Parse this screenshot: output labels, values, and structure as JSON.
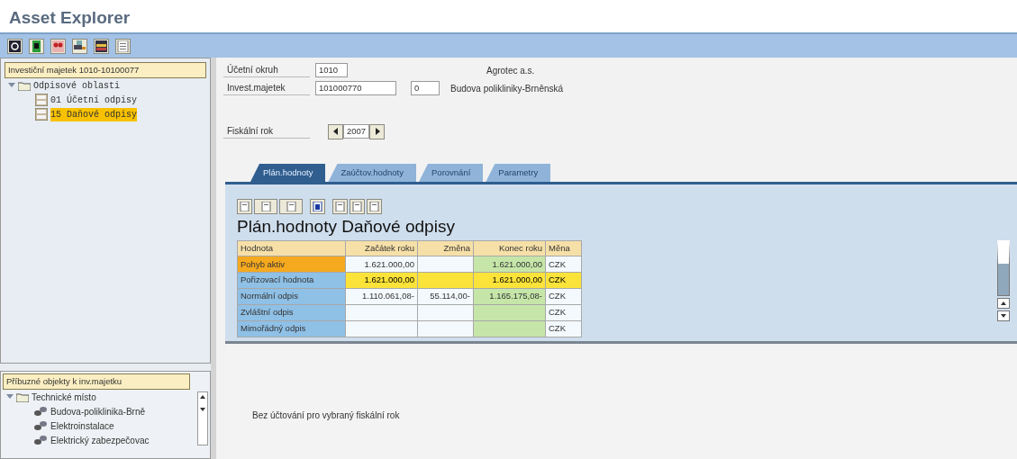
{
  "window": {
    "title": "Asset Explorer"
  },
  "left_panel": {
    "header": "Investiční majetek 1010-10100077",
    "tree": [
      {
        "label": "Odpisové oblasti",
        "expanded": true,
        "selected": false,
        "children": [
          {
            "label": "01 Účetní odpisy",
            "selected": false
          },
          {
            "label": "15 Daňové odpisy",
            "selected": true
          }
        ]
      }
    ]
  },
  "related_panel": {
    "header": "Příbuzné objekty k inv.majetku",
    "tree": [
      {
        "label": "Technické místo",
        "expanded": true,
        "children": [
          {
            "label": "Budova-poliklinika-Brně"
          },
          {
            "label": "Elektroinstalace"
          },
          {
            "label": "Elektrický zabezpečovac"
          }
        ]
      }
    ]
  },
  "fields": [
    {
      "label": "Účetní okruh",
      "value": "1010",
      "description": "Agrotec a.s."
    },
    {
      "label": "Invest.majetek",
      "value": "101000770",
      "extra": "0",
      "description": "Budova polikliniky-Brněnská"
    }
  ],
  "fiscal_year": {
    "label": "Fiskální rok",
    "value": "2007"
  },
  "tabs": [
    {
      "label": "Plán.hodnoty",
      "selected": true
    },
    {
      "label": "Zaúčtov.hodnoty",
      "selected": false
    },
    {
      "label": "Porovnání",
      "selected": false
    },
    {
      "label": "Parametry",
      "selected": false
    }
  ],
  "grid": {
    "title": "Plán.hodnoty Daňové odpisy",
    "columns": [
      "Hodnota",
      "Začátek roku",
      "Změna",
      "Konec roku",
      "Měna"
    ],
    "rows": [
      {
        "cells": [
          "Pohyb aktiv",
          "1.621.000,00",
          "",
          "1.621.000,00",
          "CZK"
        ],
        "selected": true,
        "highlighted": false
      },
      {
        "cells": [
          "Pořizovací hodnota",
          "1.621.000,00",
          "",
          "1.621.000,00",
          "CZK"
        ],
        "selected": false,
        "highlighted": true
      },
      {
        "cells": [
          "Normální odpis",
          "1.110.061,08-",
          "55.114,00-",
          "1.165.175,08-",
          "CZK"
        ],
        "selected": false,
        "highlighted": false
      },
      {
        "cells": [
          "Zvláštní odpis",
          "",
          "",
          "",
          "CZK"
        ],
        "selected": false,
        "highlighted": false
      },
      {
        "cells": [
          "Mimořádný odpis",
          "",
          "",
          "",
          "CZK"
        ],
        "selected": false,
        "highlighted": false
      }
    ]
  },
  "message": "Bez účtování pro vybraný fiskální rok"
}
